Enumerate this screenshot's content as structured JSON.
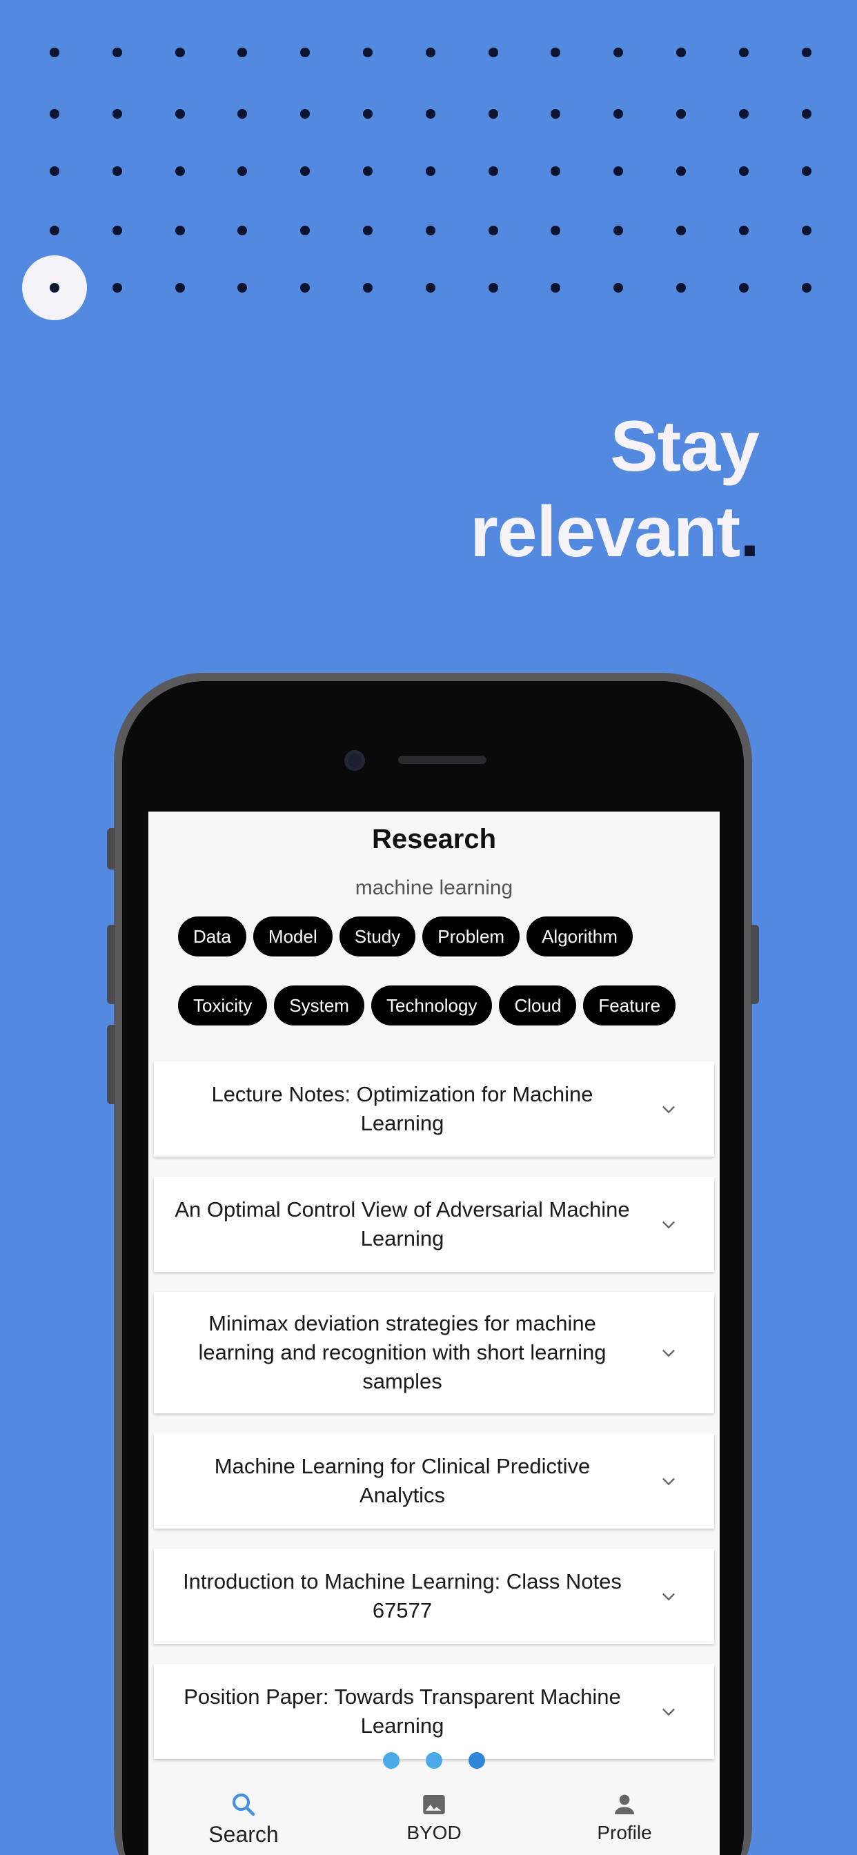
{
  "colors": {
    "background": "#5489e0",
    "dot": "#0d1430",
    "headline": "#f5f3f8",
    "chip_bg": "#000000",
    "active_tab": "#4a90e2"
  },
  "dot_grid": {
    "rows": 5,
    "cols": 13
  },
  "headline": {
    "line1": "Stay",
    "line2": "relevant",
    "period": "."
  },
  "app": {
    "title": "Research",
    "query": "machine learning",
    "chips_row1": [
      "Data",
      "Model",
      "Study",
      "Problem",
      "Algorithm"
    ],
    "chips_row2": [
      "Toxicity",
      "System",
      "Technology",
      "Cloud",
      "Feature"
    ],
    "results": [
      "Lecture Notes: Optimization for Machine Learning",
      "An Optimal Control View of Adversarial Machine Learning",
      "Minimax deviation strategies for machine learning and recognition with  short learning samples",
      "Machine Learning for Clinical Predictive Analytics",
      "Introduction to Machine Learning: Class Notes 67577",
      "Position Paper: Towards Transparent Machine Learning"
    ],
    "pager": {
      "count": 3,
      "active_index": 2
    },
    "tabs": [
      {
        "label": "Search",
        "icon": "search-icon",
        "active": true
      },
      {
        "label": "BYOD",
        "icon": "image-icon",
        "active": false
      },
      {
        "label": "Profile",
        "icon": "person-icon",
        "active": false
      }
    ]
  }
}
